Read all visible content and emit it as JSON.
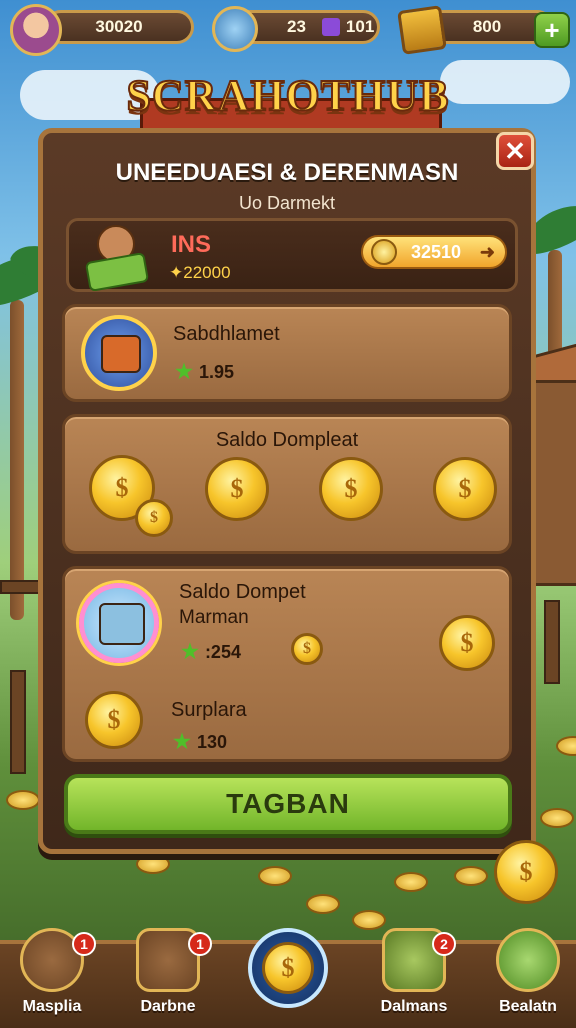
{
  "top_bar": {
    "player_coins": "30020",
    "pet_stat": "23",
    "gem_count": "101",
    "chest_coins": "800",
    "add_symbol": "+"
  },
  "logo": "SCRAHOTHUB",
  "panel": {
    "title": "UNEEDUAESI & DERENMASN",
    "subtitle": "Uo Darmekt",
    "close_symbol": "✕",
    "summary": {
      "label": "INS",
      "value": "✦22000",
      "button_value": "32510",
      "button_arrow": "➜"
    },
    "cards": [
      {
        "title": "Sabdhlamet",
        "value": "1.95"
      },
      {
        "title": "Saldo Dompleat"
      },
      {
        "title": "Saldo Dompet",
        "subtitle": "Marman",
        "value": ":254"
      },
      {
        "title": "Surplara",
        "value": "130"
      }
    ],
    "coin_symbol": "$",
    "cta_label": "TAGBAN"
  },
  "nav": {
    "items": [
      {
        "label": "Masplia",
        "badge": "1"
      },
      {
        "label": "Darbne",
        "badge": "1"
      },
      {
        "label": ""
      },
      {
        "label": "Dalmans",
        "badge": "2"
      },
      {
        "label": "Bealatn"
      }
    ]
  },
  "colors": {
    "panel_bg": "#4a2f1e",
    "card_bg": "#a8744a",
    "cta_green": "#8ccc3c",
    "gold": "#f7c52b",
    "close_red": "#c8331e"
  }
}
